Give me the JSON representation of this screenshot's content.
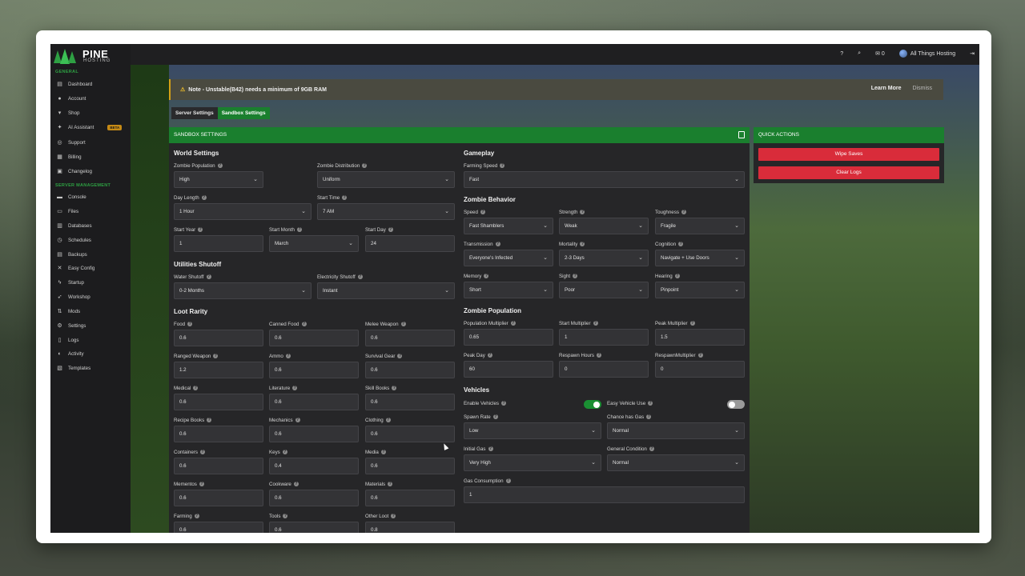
{
  "brand": {
    "name": "PINE",
    "sub": "HOSTING"
  },
  "sidebar": {
    "general_label": "GENERAL",
    "management_label": "SERVER MANAGEMENT",
    "general": [
      {
        "label": "Dashboard",
        "icon": "dashboard-icon"
      },
      {
        "label": "Account",
        "icon": "user-icon"
      },
      {
        "label": "Shop",
        "icon": "cart-icon"
      },
      {
        "label": "AI Assistant",
        "icon": "sparkle-icon",
        "badge": "BETA"
      },
      {
        "label": "Support",
        "icon": "globe-icon"
      },
      {
        "label": "Billing",
        "icon": "billing-icon"
      },
      {
        "label": "Changelog",
        "icon": "changelog-icon"
      }
    ],
    "management": [
      {
        "label": "Console",
        "icon": "console-icon"
      },
      {
        "label": "Files",
        "icon": "folder-icon"
      },
      {
        "label": "Databases",
        "icon": "database-icon"
      },
      {
        "label": "Schedules",
        "icon": "clock-icon"
      },
      {
        "label": "Backups",
        "icon": "backup-icon"
      },
      {
        "label": "Easy Config",
        "icon": "wrench-icon"
      },
      {
        "label": "Startup",
        "icon": "bolt-icon"
      },
      {
        "label": "Workshop",
        "icon": "rocket-icon"
      },
      {
        "label": "Mods",
        "icon": "swap-icon"
      },
      {
        "label": "Settings",
        "icon": "gear-icon"
      },
      {
        "label": "Logs",
        "icon": "file-icon"
      },
      {
        "label": "Activity",
        "icon": "activity-icon"
      },
      {
        "label": "Templates",
        "icon": "template-icon"
      }
    ]
  },
  "topbar": {
    "help": "?",
    "messages_count": "0",
    "account": "All Things Hosting"
  },
  "notice": {
    "text": "Note - Unstable(B42) needs a minimum of 9GB RAM",
    "learn_more": "Learn More",
    "dismiss": "Dismiss"
  },
  "tabs": [
    "Server Settings",
    "Sandbox Settings"
  ],
  "sandbox": {
    "header": "SANDBOX SETTINGS",
    "world_title": "World Settings",
    "world": {
      "zombie_population": {
        "label": "Zombie Population",
        "value": "High"
      },
      "zombie_distribution": {
        "label": "Zombie Distribution",
        "value": "Uniform"
      },
      "day_length": {
        "label": "Day Length",
        "value": "1 Hour"
      },
      "start_time": {
        "label": "Start Time",
        "value": "7 AM"
      },
      "start_year": {
        "label": "Start Year",
        "value": "1"
      },
      "start_month": {
        "label": "Start Month",
        "value": "March"
      },
      "start_day": {
        "label": "Start Day",
        "value": "24"
      }
    },
    "utilities_title": "Utilities Shutoff",
    "utilities": {
      "water": {
        "label": "Water Shutoff",
        "value": "0-2 Months"
      },
      "electricity": {
        "label": "Electricity Shutoff",
        "value": "Instant"
      }
    },
    "loot_title": "Loot Rarity",
    "loot": [
      {
        "label": "Food",
        "value": "0.6"
      },
      {
        "label": "Canned Food",
        "value": "0.6"
      },
      {
        "label": "Melee Weapon",
        "value": "0.6"
      },
      {
        "label": "Ranged Weapon",
        "value": "1.2"
      },
      {
        "label": "Ammo",
        "value": "0.6"
      },
      {
        "label": "Survival Gear",
        "value": "0.6"
      },
      {
        "label": "Medical",
        "value": "0.6"
      },
      {
        "label": "Literature",
        "value": "0.6"
      },
      {
        "label": "Skill Books",
        "value": "0.6"
      },
      {
        "label": "Recipe Books",
        "value": "0.6"
      },
      {
        "label": "Mechanics",
        "value": "0.6"
      },
      {
        "label": "Clothing",
        "value": "0.6"
      },
      {
        "label": "Containers",
        "value": "0.6"
      },
      {
        "label": "Keys",
        "value": "0.4"
      },
      {
        "label": "Media",
        "value": "0.6"
      },
      {
        "label": "Mementos",
        "value": "0.6"
      },
      {
        "label": "Cookware",
        "value": "0.6"
      },
      {
        "label": "Materials",
        "value": "0.6"
      },
      {
        "label": "Farming",
        "value": "0.6"
      },
      {
        "label": "Tools",
        "value": "0.6"
      },
      {
        "label": "Other Loot",
        "value": "0.8"
      }
    ],
    "gameplay_title": "Gameplay",
    "farming_speed": {
      "label": "Farming Speed",
      "value": "Fast"
    },
    "behavior_title": "Zombie Behavior",
    "behavior": [
      {
        "label": "Speed",
        "value": "Fast Shamblers"
      },
      {
        "label": "Strength",
        "value": "Weak"
      },
      {
        "label": "Toughness",
        "value": "Fragile"
      },
      {
        "label": "Transmission",
        "value": "Everyone's Infected"
      },
      {
        "label": "Mortality",
        "value": "2-3 Days"
      },
      {
        "label": "Cognition",
        "value": "Navigate + Use Doors"
      },
      {
        "label": "Memory",
        "value": "Short"
      },
      {
        "label": "Sight",
        "value": "Poor"
      },
      {
        "label": "Hearing",
        "value": "Pinpoint"
      }
    ],
    "population_title": "Zombie Population",
    "population": [
      {
        "label": "Population Multiplier",
        "value": "0.65"
      },
      {
        "label": "Start Multiplier",
        "value": "1"
      },
      {
        "label": "Peak Multiplier",
        "value": "1.5"
      },
      {
        "label": "Peak Day",
        "value": "60"
      },
      {
        "label": "Respawn Hours",
        "value": "0"
      },
      {
        "label": "RespawnMultiplier",
        "value": "0"
      }
    ],
    "vehicles_title": "Vehicles",
    "vehicles": {
      "enable": {
        "label": "Enable Vehicles",
        "on": true
      },
      "easy_use": {
        "label": "Easy Vehicle Use",
        "on": false
      },
      "spawn_rate": {
        "label": "Spawn Rate",
        "value": "Low"
      },
      "chance_gas": {
        "label": "Chance has Gas",
        "value": "Normal"
      },
      "initial_gas": {
        "label": "Initial Gas",
        "value": "Very High"
      },
      "general_condition": {
        "label": "General Condition",
        "value": "Normal"
      },
      "gas_consumption": {
        "label": "Gas Consumption",
        "value": "1"
      }
    }
  },
  "quick_actions": {
    "header": "QUICK ACTIONS",
    "wipe": "Wipe Saves",
    "clear": "Clear Logs"
  },
  "colors": {
    "accent": "#1a7f2e",
    "danger": "#d92c3a",
    "warning": "#d4a017"
  }
}
